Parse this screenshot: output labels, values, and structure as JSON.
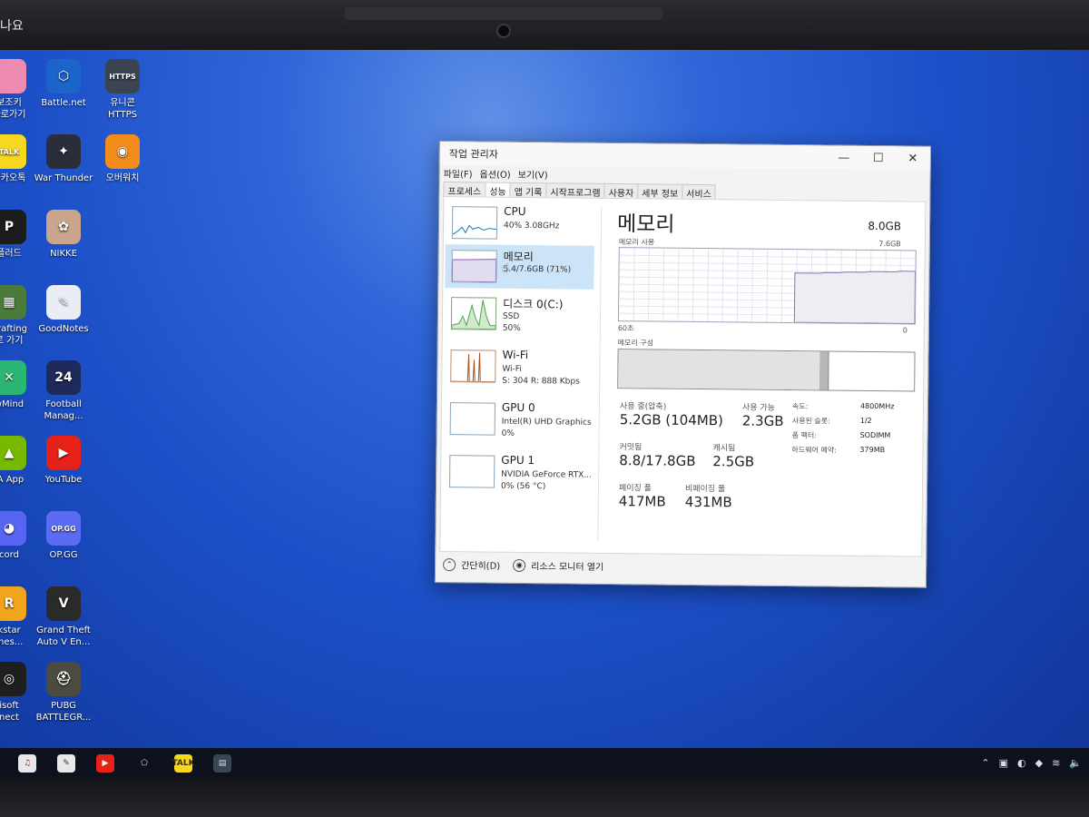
{
  "top_left_text": "나요",
  "desktop_icons": [
    {
      "label": "보조키\n바로가기",
      "img": "",
      "color": "#ef8ab0"
    },
    {
      "label": "Battle.net",
      "img": "⬡",
      "color": "#1b64c9"
    },
    {
      "label": "유니콘\nHTTPS",
      "img": "HTTPS",
      "color": "#3b4552"
    },
    {
      "label": "카카오톡",
      "img": "TALK",
      "color": "#f7d81e"
    },
    {
      "label": "War Thunder",
      "img": "✦",
      "color": "#2a2e3a"
    },
    {
      "label": "오버워치",
      "img": "◉",
      "color": "#f28d1c"
    },
    {
      "label": "플러드",
      "img": "P",
      "color": "#1c1c1c"
    },
    {
      "label": "NIKKE",
      "img": "✿",
      "color": "#c9a58d"
    },
    {
      "label": "Crafting\n로 가기",
      "img": "▦",
      "color": "#4a7b3a"
    },
    {
      "label": "GoodNotes",
      "img": "✎",
      "color": "#e9eef4"
    },
    {
      "label": "wMind",
      "img": "✕",
      "color": "#2bb673"
    },
    {
      "label": "Football\nManag...",
      "img": "24",
      "color": "#1f2a5c"
    },
    {
      "label": "IA App",
      "img": "▲",
      "color": "#76b900"
    },
    {
      "label": "YouTube",
      "img": "▶",
      "color": "#e62117"
    },
    {
      "label": "cord",
      "img": "◕",
      "color": "#5865f2"
    },
    {
      "label": "OP.GG",
      "img": "OP.GG",
      "color": "#5b6cf2"
    },
    {
      "label": "kstar\nmes...",
      "img": "R",
      "color": "#f3a51b"
    },
    {
      "label": "Grand Theft\nAuto V En...",
      "img": "V",
      "color": "#2a2a2a"
    },
    {
      "label": "isoft\nnect",
      "img": "◎",
      "color": "#1f1f1f"
    },
    {
      "label": "PUBG\nBATTLEGR...",
      "img": "⛑",
      "color": "#4b4b3f"
    }
  ],
  "window": {
    "title": "작업 관리자",
    "menu": [
      "파일(F)",
      "옵션(O)",
      "보기(V)"
    ],
    "tabs": [
      "프로세스",
      "성능",
      "앱 기록",
      "시작프로그램",
      "사용자",
      "세부 정보",
      "서비스"
    ],
    "active_tab": "성능"
  },
  "sidebar": [
    {
      "name": "CPU",
      "sub1": "40%  3.08GHz",
      "sub2": ""
    },
    {
      "name": "메모리",
      "sub1": "5.4/7.6GB (71%)",
      "sub2": ""
    },
    {
      "name": "디스크 0(C:)",
      "sub1": "SSD",
      "sub2": "50%"
    },
    {
      "name": "Wi-Fi",
      "sub1": "Wi-Fi",
      "sub2": "S: 304  R: 888 Kbps"
    },
    {
      "name": "GPU 0",
      "sub1": "Intel(R) UHD Graphics",
      "sub2": "0%"
    },
    {
      "name": "GPU 1",
      "sub1": "NVIDIA GeForce RTX...",
      "sub2": "0% (56 °C)"
    }
  ],
  "memory": {
    "title": "메모리",
    "total": "8.0GB",
    "usage_label": "메모리 사용",
    "usage_max": "7.6GB",
    "x_left": "60초",
    "x_right": "0",
    "composition_label": "메모리 구성",
    "composition": {
      "in_use_fraction": 0.68,
      "modified_fraction": 0.03
    },
    "usage_series_fraction": [
      0,
      0,
      0,
      0,
      0,
      0,
      0,
      0,
      0,
      0,
      0,
      0,
      0,
      0,
      0,
      0,
      0,
      0,
      0,
      0,
      0,
      0,
      0,
      0,
      0,
      0,
      0,
      0,
      0,
      0,
      0,
      0,
      0,
      0,
      0,
      0.68,
      0.68,
      0.68,
      0.68,
      0.68,
      0.68,
      0.69,
      0.69,
      0.69,
      0.69,
      0.7,
      0.7,
      0.7,
      0.7,
      0.7,
      0.71,
      0.71,
      0.71,
      0.71,
      0.71,
      0.71,
      0.72,
      0.72,
      0.72,
      0.72
    ],
    "stats": {
      "in_use_label": "사용 중(압축)",
      "in_use_value": "5.2GB (104MB)",
      "available_label": "사용 가능",
      "available_value": "2.3GB",
      "committed_label": "커밋됨",
      "committed_value": "8.8/17.8GB",
      "cached_label": "캐시됨",
      "cached_value": "2.5GB",
      "paged_label": "페이징 풀",
      "paged_value": "417MB",
      "nonpaged_label": "비페이징 풀",
      "nonpaged_value": "431MB"
    },
    "specs": [
      {
        "label": "속도:",
        "value": "4800MHz"
      },
      {
        "label": "사용된 슬롯:",
        "value": "1/2"
      },
      {
        "label": "폼 팩터:",
        "value": "SODIMM"
      },
      {
        "label": "하드웨어 예약:",
        "value": "379MB"
      }
    ]
  },
  "footer": {
    "collapse": "간단히(D)",
    "resource_monitor": "리소스 모니터 열기"
  },
  "taskbar": [
    {
      "name": "music-taskbar-icon",
      "glyph": "♫",
      "color": "#e8e8e8",
      "fg": "#c0213a"
    },
    {
      "name": "notes-taskbar-icon",
      "glyph": "✎",
      "color": "#e8e8e8",
      "fg": "#333"
    },
    {
      "name": "youtube-taskbar-icon",
      "glyph": "▶",
      "color": "#e62117",
      "fg": "#fff"
    },
    {
      "name": "app-taskbar-icon",
      "glyph": "⬠",
      "color": "#0c111d",
      "fg": "#ddd"
    },
    {
      "name": "kakaotalk-taskbar-icon",
      "glyph": "TALK",
      "color": "#f7d81e",
      "fg": "#3a2c1c"
    },
    {
      "name": "taskmanager-taskbar-icon",
      "glyph": "▤",
      "color": "#3a4555",
      "fg": "#ddd"
    }
  ],
  "tray": [
    "⌃",
    "▣",
    "◐",
    "◆",
    "≋",
    "🔈"
  ]
}
